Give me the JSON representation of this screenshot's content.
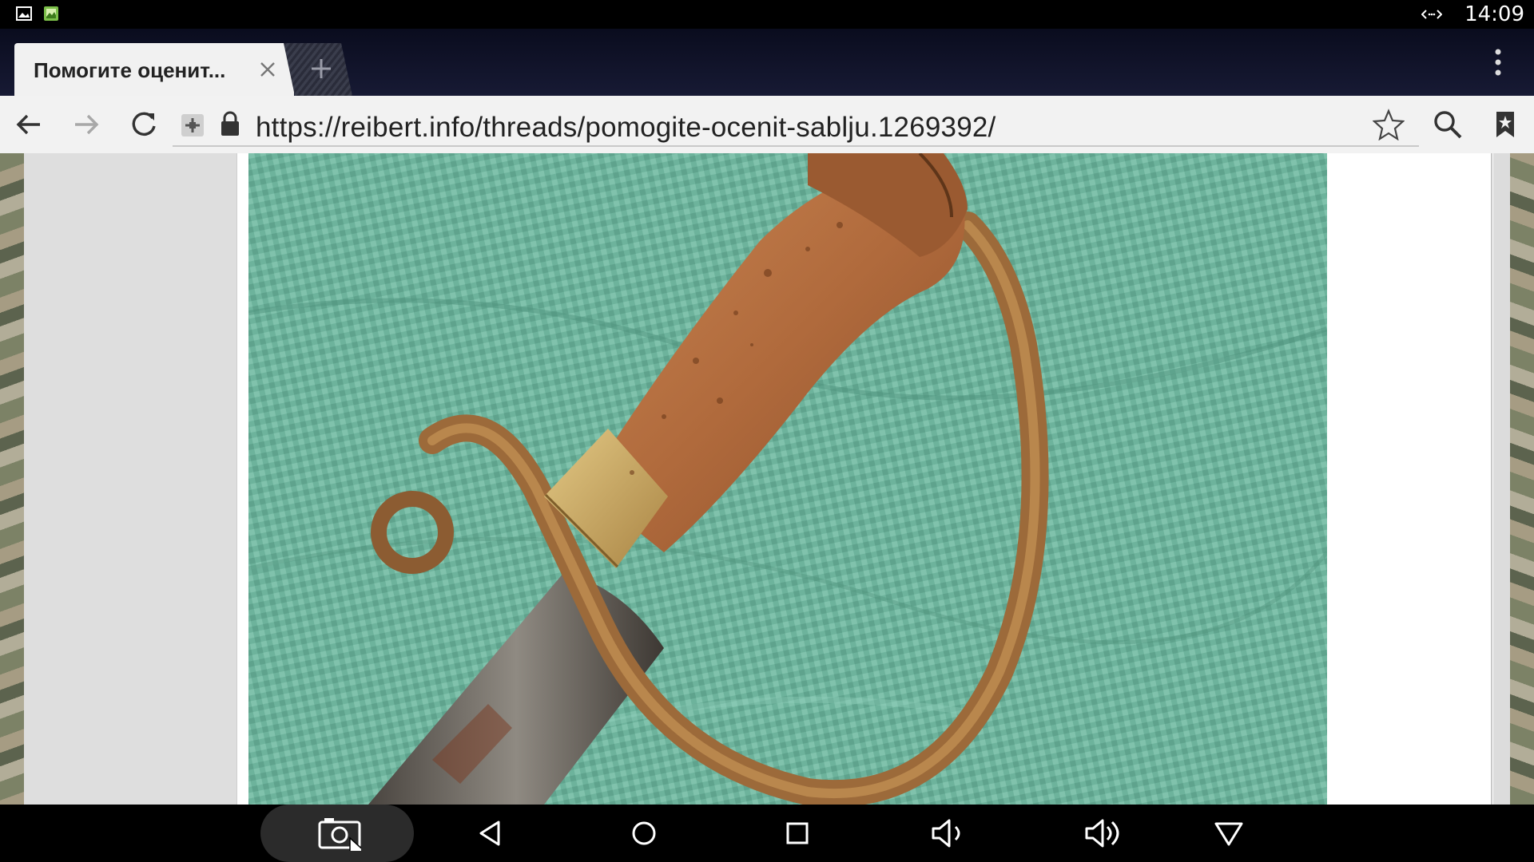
{
  "status_bar": {
    "time": "14:09",
    "left_icons": [
      "gallery-notification-icon",
      "image-notification-icon"
    ],
    "right_icons": [
      "data-transfer-icon"
    ]
  },
  "browser": {
    "tab": {
      "title": "Помогите оценит..."
    },
    "address_bar": {
      "url": "https://reibert.info/threads/pomogite-ocenit-sablju.1269392/"
    },
    "icons": [
      "back-icon",
      "forward-icon",
      "reload-icon",
      "site-info-icon",
      "lock-icon",
      "star-icon",
      "search-icon",
      "bookmarks-icon",
      "menu-icon",
      "close-icon",
      "plus-icon"
    ]
  },
  "page": {
    "image_subject": "sabre-hilt-photo"
  },
  "nav_bar": {
    "buttons": [
      "screenshot-icon",
      "back-triangle-icon",
      "home-circle-icon",
      "recents-square-icon",
      "volume-down-icon",
      "volume-up-icon",
      "hide-bar-icon"
    ]
  },
  "colors": {
    "status_bar": "#000000",
    "tab_strip": "#12152b",
    "toolbar": "#f2f2f2",
    "tarp_green": "#6fb59f",
    "handle_brown": "#b26b3e",
    "brass": "#c9a75c"
  }
}
